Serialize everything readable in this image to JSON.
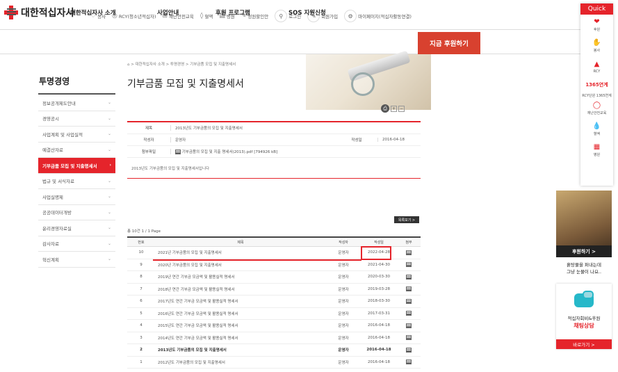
{
  "header": {
    "logo_text": "대한적십자사",
    "util": [
      {
        "icon": "heart-hands-icon",
        "glyph": "♡",
        "label": "봉사"
      },
      {
        "icon": "rcy-icon",
        "glyph": "◎",
        "label": "RCY(청소년적십자)"
      },
      {
        "icon": "safety-icon",
        "glyph": "⊞",
        "label": "재난안전교육"
      },
      {
        "icon": "blood-icon",
        "glyph": "◊",
        "label": "혈액"
      },
      {
        "icon": "hospital-icon",
        "glyph": "▤",
        "label": "병원"
      },
      {
        "icon": "sign-icon",
        "glyph": "✎",
        "label": "청원할인안"
      }
    ],
    "login_label": "로그인",
    "join_label": "회원가입",
    "mypage_label": "마이페이지(적십자활동연결)"
  },
  "nav": {
    "items": [
      "대한적십자사 소개",
      "사업안내",
      "후원 프로그램",
      "SOS 지원신청"
    ],
    "donate_label": "지금 후원하기"
  },
  "sidebar": {
    "title": "투명경영",
    "items": [
      {
        "label": "정보공개제도안내",
        "active": false
      },
      {
        "label": "경영공시",
        "active": false
      },
      {
        "label": "사업계획 및 사업실적",
        "active": false
      },
      {
        "label": "예결산자료",
        "active": false
      },
      {
        "label": "기부금품 모집 및 지출명세서",
        "active": true
      },
      {
        "label": "법규 및 서식자료",
        "active": false
      },
      {
        "label": "사업실명제",
        "active": false
      },
      {
        "label": "공공데이터개방",
        "active": false
      },
      {
        "label": "윤리경영자료실",
        "active": false
      },
      {
        "label": "감사자료",
        "active": false
      },
      {
        "label": "혁신계획",
        "active": false
      }
    ]
  },
  "main": {
    "breadcrumb": "⌂  >  대한적십자사 소개  >  투명경영  >  기부금품 모집 및 지출명세서",
    "title": "기부금품 모집 및 지출명세서",
    "detail": {
      "title_label": "제목",
      "title_value": "2013년도 기부금품의 모집 및 지출명세서",
      "author_label": "작성자",
      "author_value": "운영자",
      "date_label": "작성일",
      "date_value": "2016-04-18",
      "file_label": "첨부파일",
      "file_value": "기부금품의 모집 및 지출 명세서(2013).pdf [794926 kB]",
      "content": "2013년도 기부금품의 모집 및 지출명세서입니다"
    },
    "list_button": "목록보기 >",
    "total_text": "총 10건   1 / 1 Page",
    "columns": [
      "번호",
      "제목",
      "작성자",
      "작성일",
      "첨부"
    ],
    "rows": [
      {
        "no": "10",
        "title": "2021년 기부금품의 모집 및 지출명세서",
        "author": "운영자",
        "date": "2022-04-28",
        "bold": false
      },
      {
        "no": "9",
        "title": "2020년 기부금품의 모집 및 지출명세서",
        "author": "운영자",
        "date": "2021-04-30",
        "bold": false
      },
      {
        "no": "8",
        "title": "2019년 연간 기부금 모금액 및 활용실적 명세서",
        "author": "운영자",
        "date": "2020-03-30",
        "bold": false
      },
      {
        "no": "7",
        "title": "2018년 연간 기부금 모금액 및 활용실적 명세서",
        "author": "운영자",
        "date": "2019-03-28",
        "bold": false
      },
      {
        "no": "6",
        "title": "2017년도 연간 기부금 모금액 및 활용실적 명세서",
        "author": "운영자",
        "date": "2018-03-30",
        "bold": false
      },
      {
        "no": "5",
        "title": "2016년도 연간 기부금 모금액 및 활용실적 명세서",
        "author": "운영자",
        "date": "2017-03-31",
        "bold": false
      },
      {
        "no": "4",
        "title": "2015년도 연간 기부금 모금액 및 활용실적 명세서",
        "author": "운영자",
        "date": "2016-04-18",
        "bold": false
      },
      {
        "no": "3",
        "title": "2014년도 연간 기부금 모금액 및 활용실적 명세서",
        "author": "운영자",
        "date": "2016-04-18",
        "bold": false
      },
      {
        "no": "2",
        "title": "2013년도 기부금품의 모집 및 지출명세서",
        "author": "운영자",
        "date": "2016-04-18",
        "bold": true
      },
      {
        "no": "1",
        "title": "2012년도 기부금품의 모집 및 지출명세서",
        "author": "운영자",
        "date": "2016-04-18",
        "bold": false
      }
    ]
  },
  "quick": {
    "title": "Quick",
    "items": [
      {
        "icon": "donate-icon",
        "label": "후원"
      },
      {
        "icon": "volunteer-icon",
        "label": "봉사"
      },
      {
        "icon": "rcy-icon",
        "label": "RCY"
      },
      {
        "icon": "text",
        "label": "1365연계",
        "sub": "RCY단원 1365연계"
      },
      {
        "icon": "lifebuoy-icon",
        "label": "재난안전교육"
      },
      {
        "icon": "blood-drop-icon",
        "label": "혈액"
      },
      {
        "icon": "hospital-icon",
        "label": "병원"
      }
    ]
  },
  "ads": {
    "ad1_button": "후원하기 >",
    "ad1_text1": "흙탕물을 퍼내는데",
    "ad1_text2": "그냥 눈물이 나요..",
    "ad2_text1": "적십자회비&후원",
    "ad2_text2": "채팅상담",
    "ad2_button": "바로가기 >"
  },
  "colors": {
    "accent": "#e5242b",
    "donate": "#d8412f"
  }
}
